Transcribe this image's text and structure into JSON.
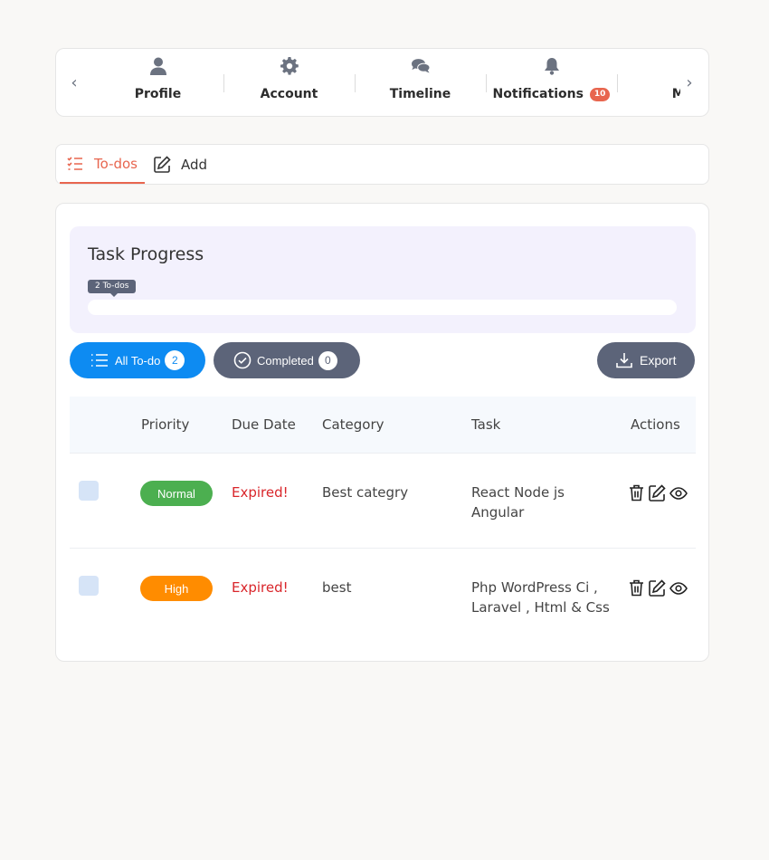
{
  "nav": {
    "items": [
      {
        "label": "Profile",
        "icon": "user-icon"
      },
      {
        "label": "Account",
        "icon": "gear-icon"
      },
      {
        "label": "Timeline",
        "icon": "chat-icon"
      },
      {
        "label": "Notifications",
        "icon": "bell-icon",
        "badge": "10"
      },
      {
        "label": "Me",
        "icon": ""
      }
    ]
  },
  "tabs": {
    "todos_label": "To-dos",
    "add_label": "Add"
  },
  "progress": {
    "title": "Task Progress",
    "tooltip": "2 To-dos",
    "completed_fraction": 0
  },
  "filters": {
    "all_label": "All To-do",
    "all_count": "2",
    "completed_label": "Completed",
    "completed_count": "0",
    "export_label": "Export"
  },
  "table": {
    "headers": [
      "Priority",
      "Due Date",
      "Category",
      "Task",
      "Actions"
    ],
    "rows": [
      {
        "priority": "Normal",
        "priority_color": "#4caf50",
        "due": "Expired!",
        "category": "Best categry",
        "task": "React Node js Angular"
      },
      {
        "priority": "High",
        "priority_color": "#ff8c00",
        "due": "Expired!",
        "category": "best",
        "task": "Php WordPress Ci , Laravel , Html & Css"
      }
    ]
  },
  "colors": {
    "accent": "#e8664f",
    "primary": "#0d8bf2",
    "secondary": "#5c6479"
  }
}
